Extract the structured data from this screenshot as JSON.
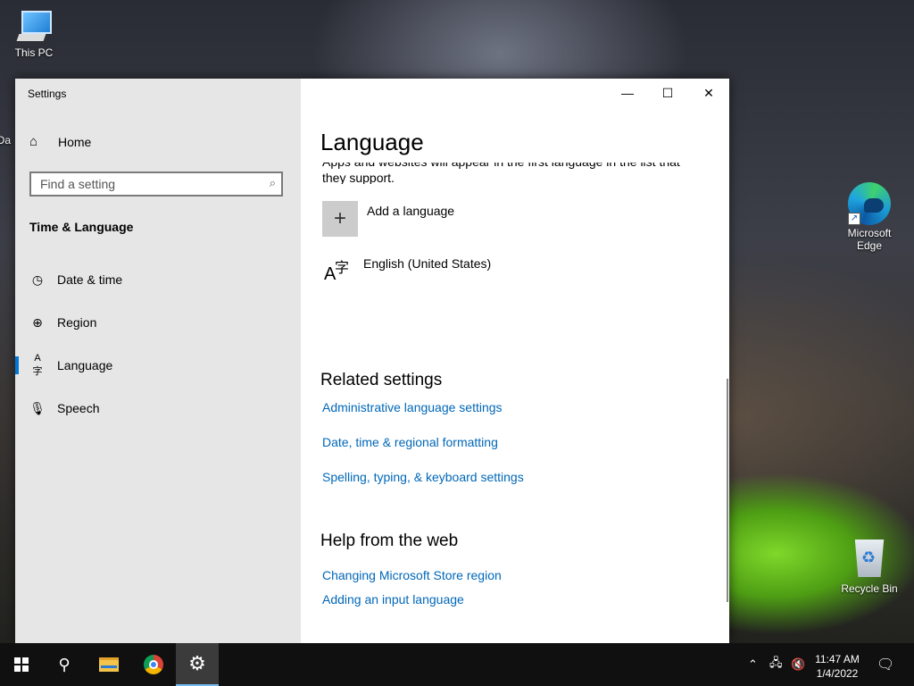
{
  "desktop": {
    "icons": [
      {
        "label": "This PC"
      },
      {
        "label": "Microsoft Edge"
      },
      {
        "label": "Recycle Bin"
      }
    ],
    "partial_label": "Da"
  },
  "window": {
    "title": "Settings",
    "controls": {
      "minimize": "—",
      "maximize": "☐",
      "close": "✕"
    }
  },
  "sidebar": {
    "home_label": "Home",
    "search_placeholder": "Find a setting",
    "section_title": "Time & Language",
    "items": [
      {
        "label": "Date & time",
        "icon": "clock-icon"
      },
      {
        "label": "Region",
        "icon": "globe-icon"
      },
      {
        "label": "Language",
        "icon": "language-icon",
        "active": true
      },
      {
        "label": "Speech",
        "icon": "microphone-icon"
      }
    ]
  },
  "main": {
    "title": "Language",
    "partial_text_top": "Apps and websites will appear in the first language in the list that",
    "partial_text_bottom": "they support.",
    "add_language_label": "Add a language",
    "languages": [
      {
        "label": "English (United States)"
      }
    ],
    "related_settings": {
      "heading": "Related settings",
      "links": [
        "Administrative language settings",
        "Date, time & regional formatting",
        "Spelling, typing, & keyboard settings"
      ]
    },
    "help": {
      "heading": "Help from the web",
      "links": [
        "Changing Microsoft Store region",
        "Adding an input language"
      ]
    }
  },
  "taskbar": {
    "time": "11:47 AM",
    "date": "1/4/2022",
    "accent": "#76b9ed"
  },
  "colors": {
    "link": "#0067b8",
    "active_bar": "#0078d7"
  }
}
